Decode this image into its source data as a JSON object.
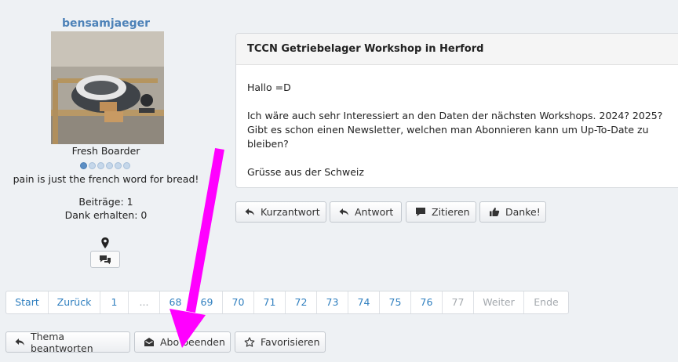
{
  "user": {
    "name": "bensamjaeger",
    "rank": "Fresh Boarder",
    "rank_level": 1,
    "rank_max": 6,
    "signature": "pain is just the french word for bread!",
    "posts": "Beiträge: 1",
    "thanks": "Dank erhalten: 0"
  },
  "post": {
    "title": "TCCN Getriebelager Workshop in Herford",
    "greeting": "Hallo =D",
    "line1": "Ich wäre auch sehr Interessiert an den Daten der nächsten Workshops. 2024? 2025?",
    "line2": "Gibt es schon einen Newsletter, welchen man Abonnieren kann um Up-To-Date zu bleiben?",
    "closing": "Grüsse aus der Schweiz"
  },
  "post_actions": {
    "quick_reply": "Kurzantwort",
    "reply": "Antwort",
    "quote": "Zitieren",
    "thanks": "Danke!"
  },
  "pagination": {
    "start": "Start",
    "prev": "Zurück",
    "p1": "1",
    "ellipsis": "...",
    "p68": "68",
    "p69": "69",
    "p70": "70",
    "p71": "71",
    "p72": "72",
    "p73": "73",
    "p74": "74",
    "p75": "75",
    "p76": "76",
    "p77": "77",
    "next": "Weiter",
    "end": "Ende"
  },
  "topic_actions": {
    "reply_topic": "Thema beantworten",
    "unsubscribe": "Abo beenden",
    "favorite": "Favorisieren"
  },
  "annotation_color": "#ff00ff"
}
